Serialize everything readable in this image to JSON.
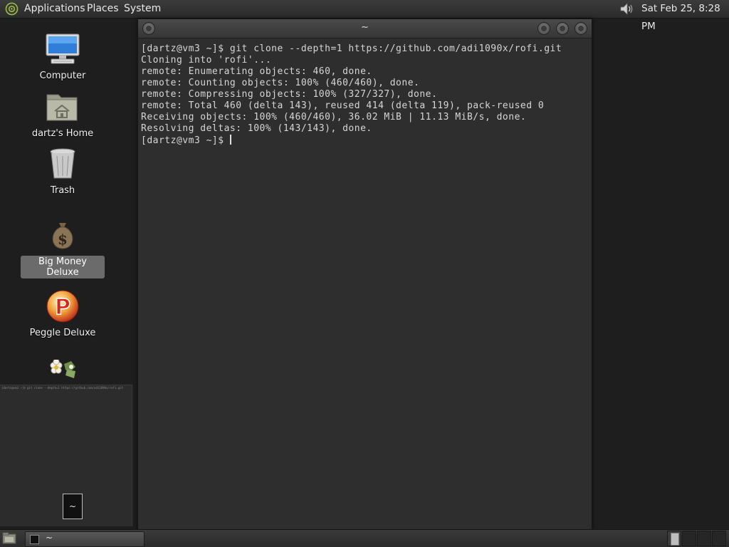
{
  "top_panel": {
    "menus": [
      "Applications",
      "Places",
      "System"
    ],
    "clock": "Sat Feb 25,  8:28 PM"
  },
  "desktop": {
    "icons": [
      {
        "label": "Computer",
        "icon": "computer-icon"
      },
      {
        "label": "dartz's Home",
        "icon": "home-folder-icon"
      },
      {
        "label": "Trash",
        "icon": "trash-icon"
      },
      {
        "label": "Big Money Deluxe",
        "icon": "money-bag-icon",
        "selected": true
      },
      {
        "label": "Peggle Deluxe",
        "icon": "peggle-icon"
      },
      {
        "label": "",
        "icon": "flowers-icon"
      }
    ]
  },
  "terminal": {
    "title": "~",
    "lines": [
      "[dartz@vm3 ~]$ git clone --depth=1 https://github.com/adi1090x/rofi.git",
      "Cloning into 'rofi'...",
      "remote: Enumerating objects: 460, done.",
      "remote: Counting objects: 100% (460/460), done.",
      "remote: Compressing objects: 100% (327/327), done.",
      "remote: Total 460 (delta 143), reused 414 (delta 119), pack-reused 0",
      "Receiving objects: 100% (460/460), 36.02 MiB | 11.13 MiB/s, done.",
      "Resolving deltas: 100% (143/143), done."
    ],
    "prompt": "[dartz@vm3 ~]$ "
  },
  "workspace_preview": {
    "tile_label": "~"
  },
  "bottom_panel": {
    "task_label": "~"
  },
  "colors": {
    "panel": "#2f2f2f",
    "terminal_bg": "#2e2e2e",
    "terminal_fg": "#d6d6d6",
    "selection": "#6b6b6b"
  }
}
